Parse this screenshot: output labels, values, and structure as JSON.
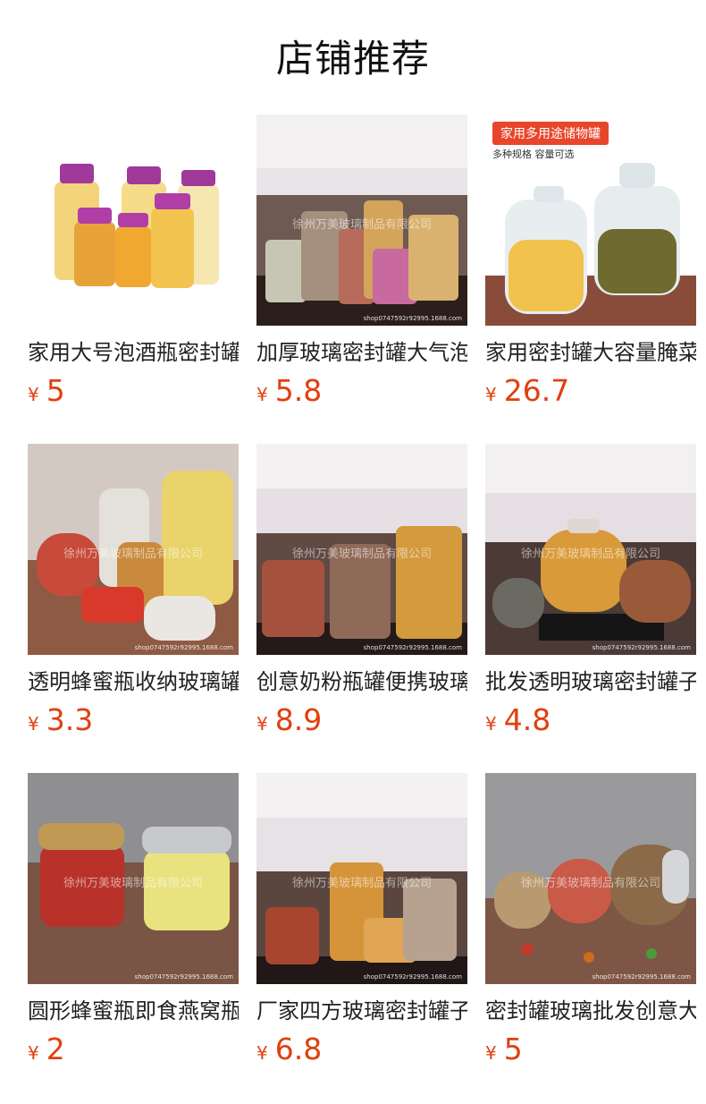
{
  "page": {
    "title": "店铺推荐"
  },
  "watermark": "徐州万美玻璃制品有限公司",
  "shop_id": "shop0747592r92995.1688.com",
  "currency": "¥",
  "products": [
    {
      "name": "家用大号泡酒瓶密封罐",
      "price": "5",
      "image": "purple-lid-oil-jars"
    },
    {
      "name": "加厚玻璃密封罐大气泡",
      "price": "5.8",
      "image": "diamond-glass-jars"
    },
    {
      "name": "家用密封罐大容量腌菜",
      "price": "26.7",
      "image": "large-storage-jars",
      "badge": "家用多用途储物罐",
      "subtext": "多种规格  容量可选"
    },
    {
      "name": "透明蜂蜜瓶收纳玻璃罐",
      "price": "3.3",
      "image": "candy-jars-wood"
    },
    {
      "name": "创意奶粉瓶罐便携玻璃",
      "price": "8.9",
      "image": "hexagon-jars-kitchen"
    },
    {
      "name": "批发透明玻璃密封罐子",
      "price": "4.8",
      "image": "round-jars-kitchen"
    },
    {
      "name": "圆形蜂蜜瓶即食燕窝瓶",
      "price": "2",
      "image": "honey-jars-wood"
    },
    {
      "name": "厂家四方玻璃密封罐子",
      "price": "6.8",
      "image": "square-jars-kitchen"
    },
    {
      "name": "密封罐玻璃批发创意大",
      "price": "5",
      "image": "tilted-jars-wood"
    }
  ]
}
